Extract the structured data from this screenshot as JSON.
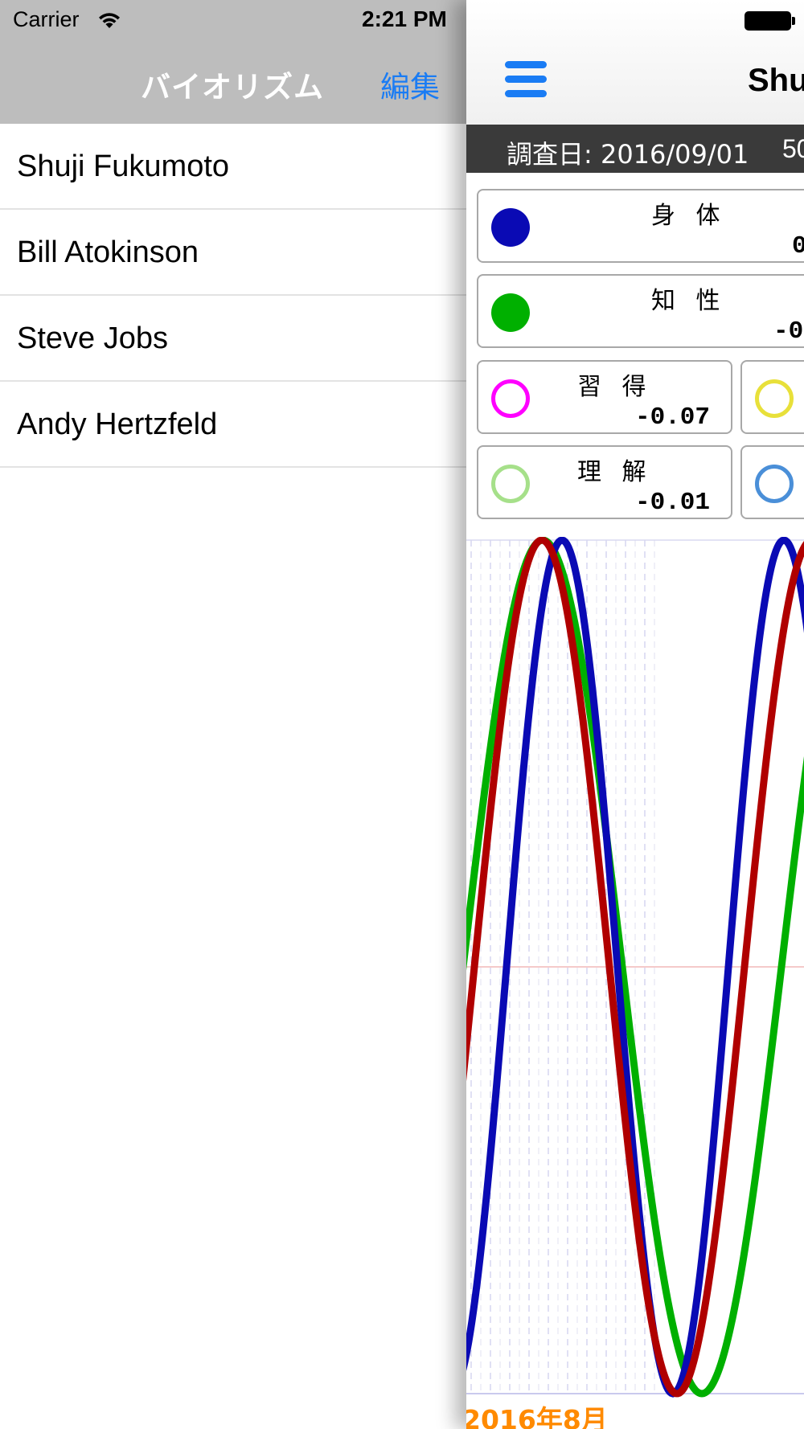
{
  "status_bar": {
    "carrier": "Carrier",
    "time": "2:21 PM"
  },
  "master": {
    "title": "バイオリズム",
    "edit_label": "編集",
    "people": [
      "Shuji Fukumoto",
      "Bill Atokinson",
      "Steve Jobs",
      "Andy Hertzfeld"
    ]
  },
  "detail": {
    "title_partial": "Shu",
    "survey_date": "調査日: 2016/09/01",
    "age_partial": "50",
    "cards": [
      {
        "label": "身 体",
        "value": "0.",
        "dot_color": "#0a0ab4",
        "dot_style": "filled"
      },
      {
        "label": "知 性",
        "value": "-0.",
        "dot_color": "#00b000",
        "dot_style": "filled"
      },
      {
        "label": "習 得",
        "value": "-0.07",
        "dot_color": "#ff00ff",
        "dot_style": "outline"
      },
      {
        "label": "理 解",
        "value": "-0.01",
        "dot_color": "#a6e08a",
        "dot_style": "outline"
      },
      {
        "label": "",
        "value": "",
        "dot_color": "#e8e03a",
        "dot_style": "outline"
      },
      {
        "label": "",
        "value": "",
        "dot_color": "#4a8fd8",
        "dot_style": "outline"
      }
    ],
    "month_label": "2016年8月"
  },
  "chart_data": {
    "type": "line",
    "ylim": [
      -1,
      1
    ],
    "series": [
      {
        "color": "#00b000",
        "period_days": 33
      },
      {
        "color": "#0a0ab4",
        "period_days": 23
      },
      {
        "color": "#b00000",
        "period_days": 28
      }
    ]
  },
  "colors": {
    "accent": "#1a7cf4",
    "nav_bg": "#bdbdbd",
    "date_bar": "#3a3a3a",
    "month_label": "#ff8a00"
  }
}
